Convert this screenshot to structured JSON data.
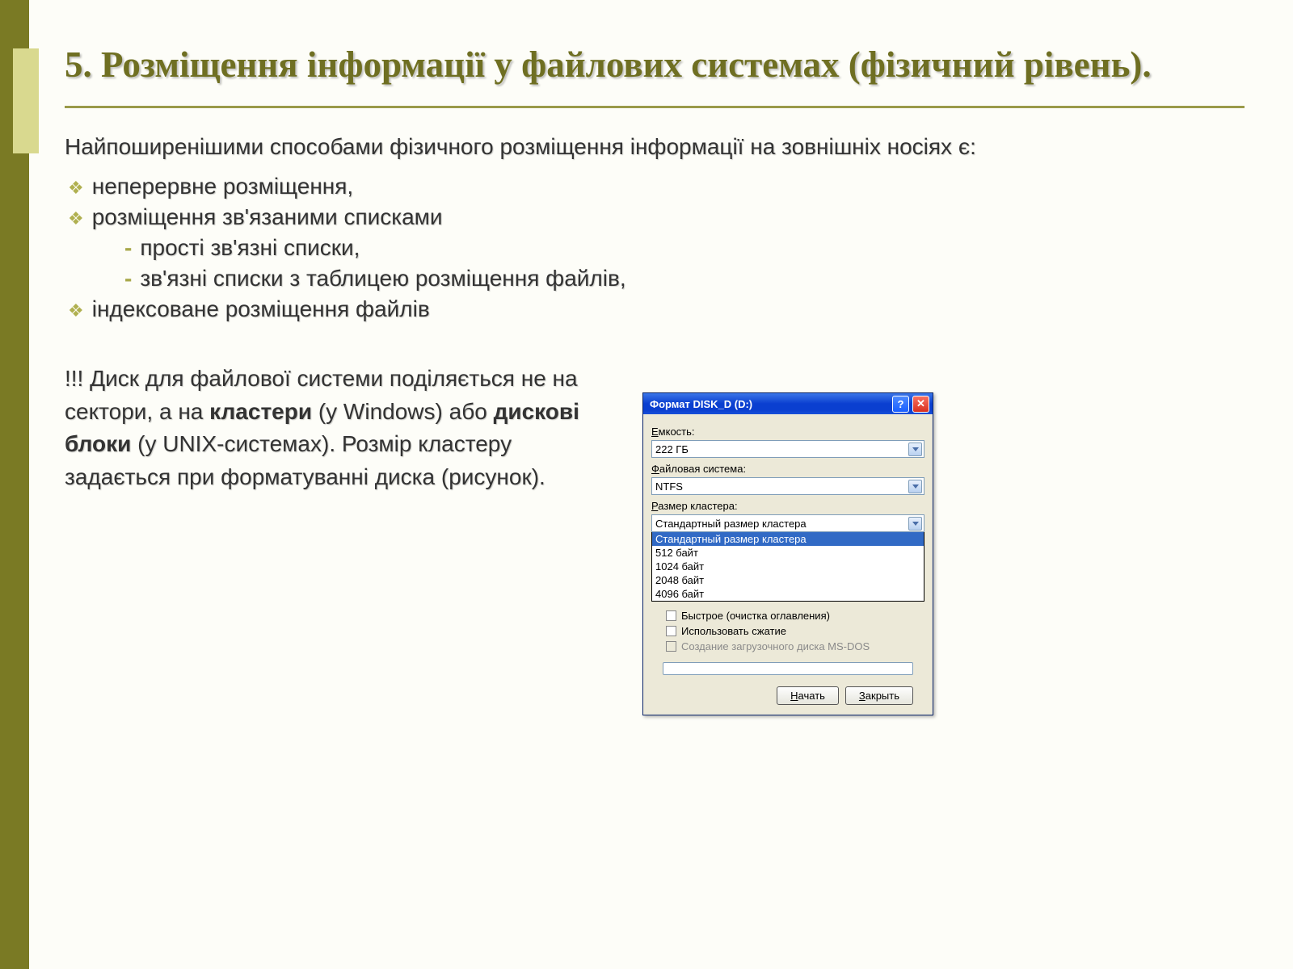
{
  "title": "5. Розміщення інформації у файлових системах (фізичний рівень).",
  "intro": "Найпоширенішими способами фізичного розміщення інформації на зовнішніх носіях є:",
  "bullets": [
    "неперервне розміщення,",
    "розміщення зв'язаними списками",
    "індексоване розміщення файлів"
  ],
  "sub_bullets": [
    "прості зв'язні списки,",
    "зв'язні списки з таблицею розміщення файлів,"
  ],
  "note_prefix": "!!! Диск для файлової системи поділяється не на сектори, а на ",
  "note_b1": "кластери",
  "note_mid1": " (у Windows) або ",
  "note_b2": "дискові блоки",
  "note_mid2": " (у UNIX-системах). Розмір кластеру задається при форматуванні диска (рисунок).",
  "dialog": {
    "title": "Формат DISK_D (D:)",
    "labels": {
      "capacity_u": "Е",
      "capacity_rest": "мкость:",
      "fs_u": "Ф",
      "fs_rest": "айловая система:",
      "cluster_u": "Р",
      "cluster_rest": "азмер кластера:"
    },
    "capacity_value": "222 ГБ",
    "fs_value": "NTFS",
    "cluster_value": "Стандартный размер кластера",
    "cluster_options": [
      "Стандартный размер кластера",
      "512 байт",
      "1024 байт",
      "2048 байт",
      "4096 байт"
    ],
    "checks": {
      "quick_u": "Б",
      "quick_rest": "ыстрое (очистка оглавления)",
      "comp_u": "И",
      "comp_rest": "спользовать сжатие",
      "msdos": "Создание загрузочного диска MS-DOS"
    },
    "buttons": {
      "start_u": "Н",
      "start_rest": "ачать",
      "close_u": "З",
      "close_rest": "акрыть"
    }
  }
}
